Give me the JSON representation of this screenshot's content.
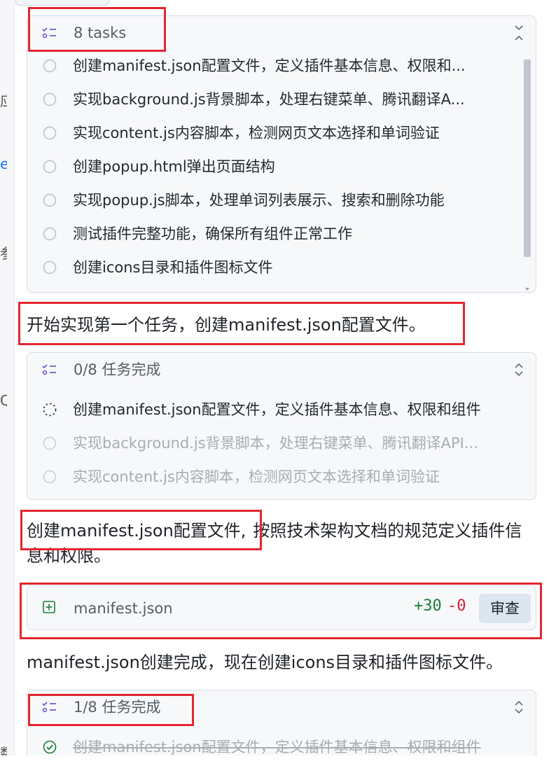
{
  "task_list_1": {
    "title": "8 tasks",
    "tasks": [
      {
        "label": "创建manifest.json配置文件，定义插件基本信息、权限和..."
      },
      {
        "label": "实现background.js背景脚本，处理右键菜单、腾讯翻译A..."
      },
      {
        "label": "实现content.js内容脚本，检测网页文本选择和单词验证"
      },
      {
        "label": "创建popup.html弹出页面结构"
      },
      {
        "label": "实现popup.js脚本，处理单词列表展示、搜索和删除功能"
      },
      {
        "label": "测试插件完整功能，确保所有组件正常工作"
      },
      {
        "label": "创建icons目录和插件图标文件"
      }
    ]
  },
  "message_1": "开始实现第一个任务，创建manifest.json配置文件。",
  "task_list_2": {
    "title": "0/8 任务完成",
    "tasks": [
      {
        "label": "创建manifest.json配置文件，定义插件基本信息、权限和组件",
        "status": "in-progress"
      },
      {
        "label": "实现background.js背景脚本，处理右键菜单、腾讯翻译API...",
        "status": "pending"
      },
      {
        "label": "实现content.js内容脚本，检测网页文本选择和单词验证",
        "status": "pending"
      }
    ]
  },
  "message_2": {
    "highlight": "创建manifest.json配置文件,",
    "rest": "按照技术架构文档的规范定义插件信息和权限。"
  },
  "file_change": {
    "filename": "manifest.json",
    "additions": "+30",
    "deletions": "-0",
    "review_label": "审查"
  },
  "message_3": "manifest.json创建完成，现在创建icons目录和插件图标文件。",
  "task_list_3": {
    "title": "1/8 任务完成",
    "tasks": [
      {
        "label": "创建manifest.json配置文件，定义插件基本信息、权限和组件",
        "status": "done"
      }
    ]
  },
  "colors": {
    "highlight_border": "#e3262f",
    "accent_purple": "#6b5bd6",
    "diff_add": "#1a7f37",
    "diff_del": "#cf222e",
    "done_green": "#1a7f37"
  }
}
